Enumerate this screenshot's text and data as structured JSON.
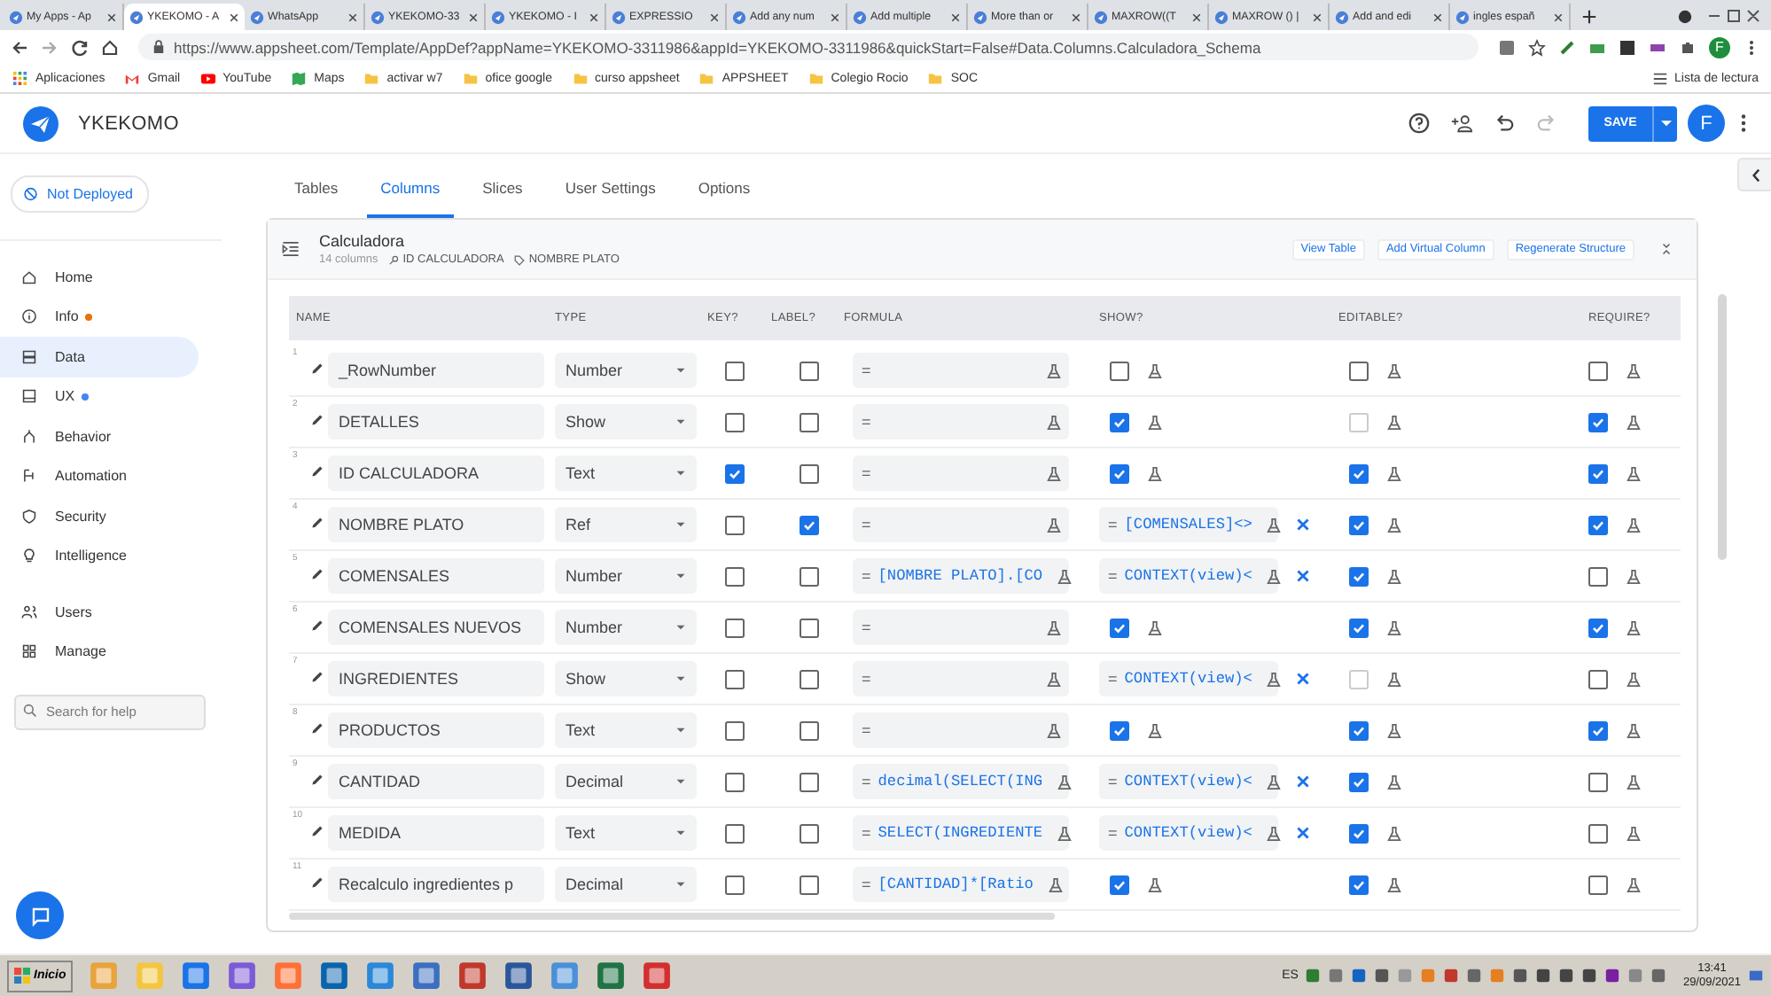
{
  "browser": {
    "tabs": [
      {
        "title": "My Apps - Ap",
        "selected": false
      },
      {
        "title": "YKEKOMO - A",
        "selected": true
      },
      {
        "title": "WhatsApp",
        "selected": false
      },
      {
        "title": "YKEKOMO-33",
        "selected": false
      },
      {
        "title": "YKEKOMO - I",
        "selected": false
      },
      {
        "title": "EXPRESSIO",
        "selected": false
      },
      {
        "title": "Add any num",
        "selected": false
      },
      {
        "title": "Add multiple",
        "selected": false
      },
      {
        "title": "More than or",
        "selected": false
      },
      {
        "title": "MAXROW((T",
        "selected": false
      },
      {
        "title": "MAXROW () |",
        "selected": false
      },
      {
        "title": "Add and edi",
        "selected": false
      },
      {
        "title": "ingles españ",
        "selected": false
      }
    ],
    "url": "https://www.appsheet.com/Template/AppDef?appName=YKEKOMO-3311986&appId=YKEKOMO-3311986&quickStart=False#Data.Columns.Calculadora_Schema",
    "profile": "F",
    "bookmarks": [
      {
        "label": "Aplicaciones",
        "kind": "apps"
      },
      {
        "label": "Gmail",
        "kind": "gmail"
      },
      {
        "label": "YouTube",
        "kind": "youtube"
      },
      {
        "label": "Maps",
        "kind": "maps"
      },
      {
        "label": "activar w7",
        "kind": "folder"
      },
      {
        "label": "ofice google",
        "kind": "folder"
      },
      {
        "label": "curso appsheet",
        "kind": "folder"
      },
      {
        "label": "APPSHEET",
        "kind": "folder"
      },
      {
        "label": "Colegio Rocio",
        "kind": "folder"
      },
      {
        "label": "SOC",
        "kind": "folder"
      }
    ],
    "reading_list": "Lista de lectura"
  },
  "app": {
    "name": "YKEKOMO",
    "save": "SAVE",
    "avatar": "F"
  },
  "sidebar": {
    "deploy": "Not Deployed",
    "items": [
      {
        "label": "Home",
        "selected": false
      },
      {
        "label": "Info",
        "selected": false,
        "color": "#e8710a"
      },
      {
        "label": "Data",
        "selected": true
      },
      {
        "label": "UX",
        "selected": false,
        "color": "#4285f4"
      },
      {
        "label": "Behavior",
        "selected": false
      },
      {
        "label": "Automation",
        "selected": false
      },
      {
        "label": "Security",
        "selected": false
      },
      {
        "label": "Intelligence",
        "selected": false
      }
    ],
    "items2": [
      {
        "label": "Users",
        "selected": false
      },
      {
        "label": "Manage",
        "selected": false
      }
    ],
    "search": {
      "placeholder": "Search for help"
    }
  },
  "tabs": [
    {
      "label": "Tables",
      "selected": false
    },
    {
      "label": "Columns",
      "selected": true
    },
    {
      "label": "Slices",
      "selected": false
    },
    {
      "label": "User Settings",
      "selected": false
    },
    {
      "label": "Options",
      "selected": false
    }
  ],
  "table": {
    "title": "Calculadora",
    "count": "14 columns",
    "key_column": "ID CALCULADORA",
    "label_column": "NOMBRE PLATO",
    "actions": [
      "View Table",
      "Add Virtual Column",
      "Regenerate Structure"
    ],
    "columns": [
      "NAME",
      "TYPE",
      "KEY?",
      "LABEL?",
      "FORMULA",
      "SHOW?",
      "EDITABLE?",
      "REQUIRE?"
    ],
    "rows": [
      {
        "number": "1",
        "name": "_RowNumber",
        "type": "Number",
        "key": false,
        "label": false,
        "formula": {
          "sign": "="
        },
        "show": {
          "kind": "checkbox",
          "checked": false
        },
        "editable": {
          "checked": false,
          "disabled": false
        },
        "required": false
      },
      {
        "number": "2",
        "name": "DETALLES",
        "type": "Show",
        "key": false,
        "label": false,
        "formula": {
          "sign": "="
        },
        "show": {
          "kind": "checkbox",
          "checked": true
        },
        "editable": {
          "checked": false,
          "disabled": true
        },
        "required": true
      },
      {
        "number": "3",
        "name": "ID CALCULADORA",
        "type": "Text",
        "key": true,
        "label": false,
        "formula": {
          "sign": "="
        },
        "show": {
          "kind": "checkbox",
          "checked": true
        },
        "editable": {
          "checked": true,
          "disabled": false
        },
        "required": true
      },
      {
        "number": "4",
        "name": "NOMBRE PLATO",
        "type": "Ref",
        "key": false,
        "label": true,
        "formula": {
          "sign": "="
        },
        "show": {
          "kind": "formula",
          "sign": "=",
          "expr": "[COMENSALES]<>"
        },
        "editable": {
          "checked": true,
          "disabled": false
        },
        "required": true
      },
      {
        "number": "5",
        "name": "COMENSALES",
        "type": "Number",
        "key": false,
        "label": false,
        "formula": {
          "sign": "=",
          "expr": "[NOMBRE PLATO].[CO"
        },
        "show": {
          "kind": "formula",
          "sign": "=",
          "expr": "CONTEXT(view)<"
        },
        "editable": {
          "checked": true,
          "disabled": false
        },
        "required": false
      },
      {
        "number": "6",
        "name": "COMENSALES NUEVOS",
        "type": "Number",
        "key": false,
        "label": false,
        "formula": {
          "sign": "="
        },
        "show": {
          "kind": "checkbox",
          "checked": true
        },
        "editable": {
          "checked": true,
          "disabled": false
        },
        "required": true
      },
      {
        "number": "7",
        "name": "INGREDIENTES",
        "type": "Show",
        "key": false,
        "label": false,
        "formula": {
          "sign": "="
        },
        "show": {
          "kind": "formula",
          "sign": "=",
          "expr": "CONTEXT(view)<"
        },
        "editable": {
          "checked": false,
          "disabled": true
        },
        "required": false
      },
      {
        "number": "8",
        "name": "PRODUCTOS",
        "type": "Text",
        "key": false,
        "label": false,
        "formula": {
          "sign": "="
        },
        "show": {
          "kind": "checkbox",
          "checked": true
        },
        "editable": {
          "checked": true,
          "disabled": false
        },
        "required": true
      },
      {
        "number": "9",
        "name": "CANTIDAD",
        "type": "Decimal",
        "key": false,
        "label": false,
        "formula": {
          "sign": "=",
          "expr": "decimal(SELECT(ING"
        },
        "show": {
          "kind": "formula",
          "sign": "=",
          "expr": "CONTEXT(view)<"
        },
        "editable": {
          "checked": true,
          "disabled": false
        },
        "required": false
      },
      {
        "number": "10",
        "name": "MEDIDA",
        "type": "Text",
        "key": false,
        "label": false,
        "formula": {
          "sign": "=",
          "expr": "SELECT(INGREDIENTE"
        },
        "show": {
          "kind": "formula",
          "sign": "=",
          "expr": "CONTEXT(view)<"
        },
        "editable": {
          "checked": true,
          "disabled": false
        },
        "required": false
      },
      {
        "number": "11",
        "name": "Recalculo ingredientes p",
        "type": "Decimal",
        "key": false,
        "label": false,
        "formula": {
          "sign": "=",
          "expr": "[CANTIDAD]*[Ratio"
        },
        "show": {
          "kind": "checkbox",
          "checked": true
        },
        "editable": {
          "checked": true,
          "disabled": false
        },
        "required": false
      }
    ]
  },
  "taskbar": {
    "start": "Inicio",
    "lang": "ES",
    "time": "13:41",
    "date": "29/09/2021"
  }
}
